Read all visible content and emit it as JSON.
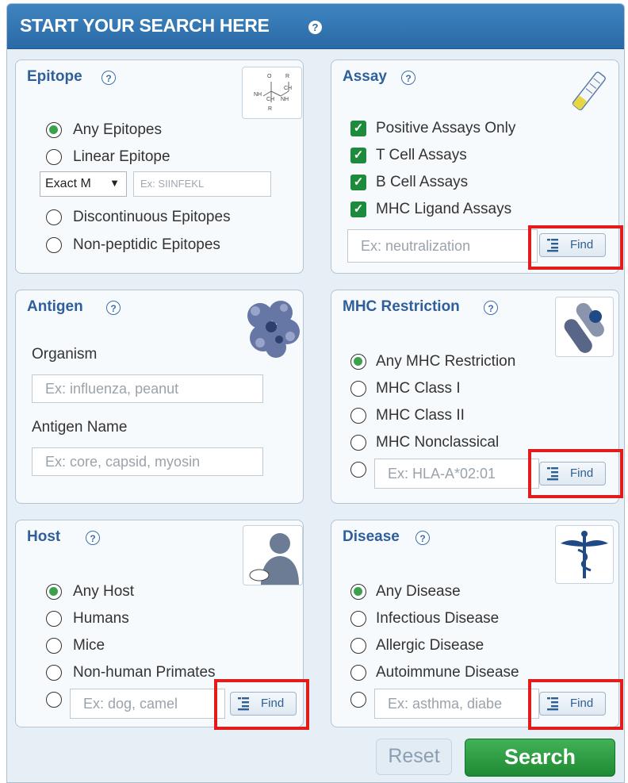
{
  "header": {
    "title": "START YOUR SEARCH HERE",
    "help": "?"
  },
  "epitope": {
    "title": "Epitope",
    "options": [
      "Any Epitopes",
      "Linear Epitope",
      "Discontinuous Epitopes",
      "Non-peptidic Epitopes"
    ],
    "selected": "Any Epitopes",
    "match_select": "Exact M",
    "sequence_placeholder": "Ex: SIINFEKL"
  },
  "assay": {
    "title": "Assay",
    "checks": [
      "Positive Assays Only",
      "T Cell Assays",
      "B Cell Assays",
      "MHC Ligand Assays"
    ],
    "placeholder": "Ex: neutralization",
    "find": "Find"
  },
  "antigen": {
    "title": "Antigen",
    "organism_label": "Organism",
    "organism_placeholder": "Ex: influenza, peanut",
    "name_label": "Antigen Name",
    "name_placeholder": "Ex: core, capsid, myosin"
  },
  "mhc": {
    "title": "MHC Restriction",
    "options": [
      "Any MHC Restriction",
      "MHC Class I",
      "MHC Class II",
      "MHC Nonclassical"
    ],
    "selected": "Any MHC Restriction",
    "placeholder": "Ex: HLA-A*02:01",
    "find": "Find"
  },
  "host": {
    "title": "Host",
    "options": [
      "Any Host",
      "Humans",
      "Mice",
      "Non-human Primates"
    ],
    "selected": "Any Host",
    "placeholder": "Ex: dog, camel",
    "find": "Find"
  },
  "disease": {
    "title": "Disease",
    "options": [
      "Any Disease",
      "Infectious Disease",
      "Allergic Disease",
      "Autoimmune Disease"
    ],
    "selected": "Any Disease",
    "placeholder": "Ex: asthma, diabe",
    "find": "Find"
  },
  "actions": {
    "reset": "Reset",
    "search": "Search"
  },
  "colors": {
    "header": "#2a6aa6",
    "highlight": "#e21b1b",
    "search_button": "#2e9e44"
  }
}
